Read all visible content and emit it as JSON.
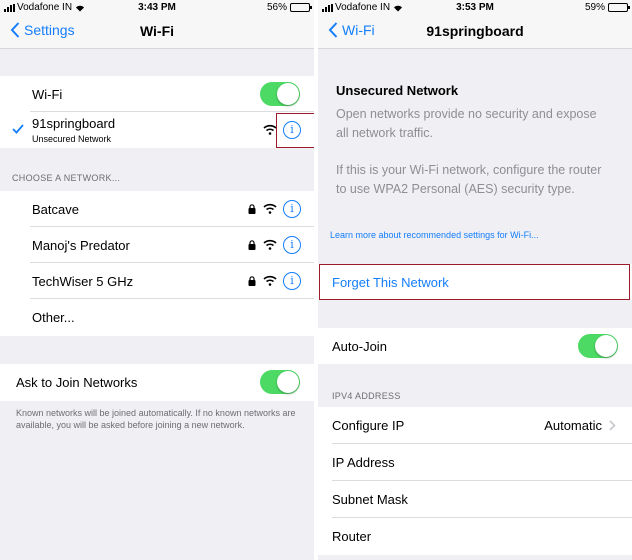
{
  "left": {
    "status": {
      "carrier": "Vodafone IN",
      "time": "3:43 PM",
      "battery": "56%",
      "battery_level": 0.56
    },
    "nav": {
      "back_label": "Settings",
      "title": "Wi-Fi"
    },
    "wifi_row": {
      "label": "Wi-Fi",
      "enabled": true
    },
    "connected": {
      "name": "91springboard",
      "subtitle": "Unsecured Network"
    },
    "choose_header": "CHOOSE A NETWORK...",
    "networks": [
      {
        "name": "Batcave"
      },
      {
        "name": "Manoj's Predator"
      },
      {
        "name": "TechWiser 5 GHz"
      }
    ],
    "other_label": "Other...",
    "ask_join": {
      "label": "Ask to Join Networks",
      "enabled": true
    },
    "footer": "Known networks will be joined automatically. If no known networks are available, you will be asked before joining a new network."
  },
  "right": {
    "status": {
      "carrier": "Vodafone IN",
      "time": "3:53 PM",
      "battery": "59%",
      "battery_level": 0.59
    },
    "nav": {
      "back_label": "Wi-Fi",
      "title": "91springboard"
    },
    "unsecured_title": "Unsecured Network",
    "unsecured_desc1": "Open networks provide no security and expose all network traffic.",
    "unsecured_desc2": "If this is your Wi-Fi network, configure the router to use WPA2 Personal (AES) security type.",
    "learn_more": "Learn more about recommended settings for Wi-Fi...",
    "forget_label": "Forget This Network",
    "auto_join": {
      "label": "Auto-Join",
      "enabled": true
    },
    "ipv4_header": "IPV4 ADDRESS",
    "configure_ip": {
      "label": "Configure IP",
      "value": "Automatic"
    },
    "ip_address_label": "IP Address",
    "subnet_label": "Subnet Mask",
    "router_label": "Router"
  },
  "colors": {
    "accent": "#147efb",
    "toggle_on": "#4cd964",
    "highlight": "#9b1c2a",
    "background": "#efeff4"
  }
}
